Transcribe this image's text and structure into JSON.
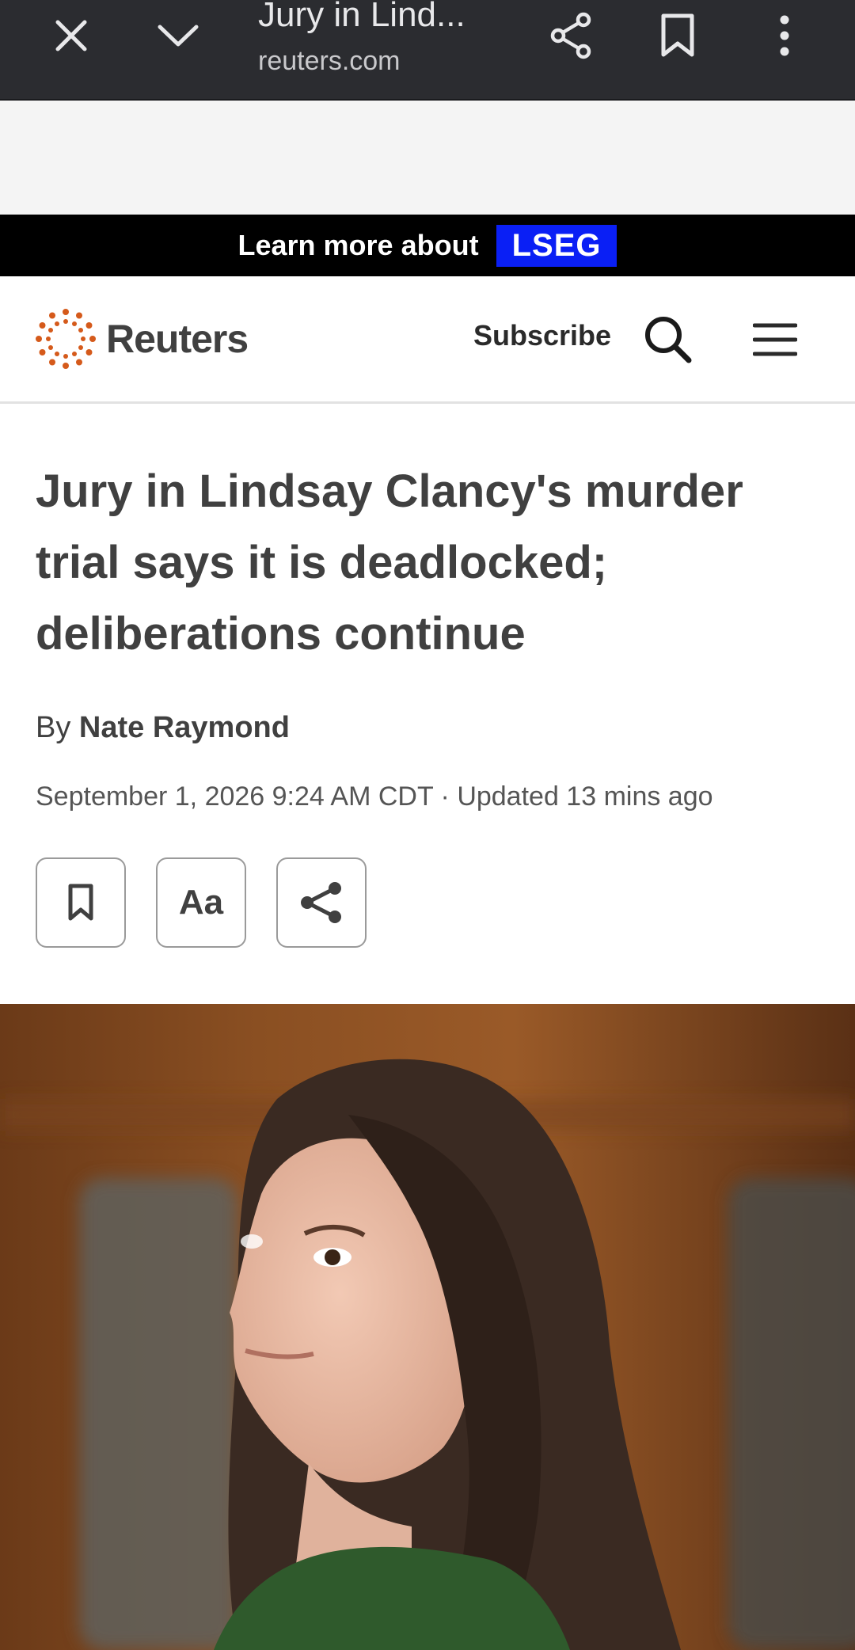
{
  "browser": {
    "tab_title": "Jury in Lind...",
    "url": "reuters.com",
    "icons": [
      "close-icon",
      "chevron-down-icon",
      "share-icon",
      "bookmark-icon",
      "more-vert-icon"
    ]
  },
  "ad": {
    "text": "Learn more about",
    "brand": "LSEG"
  },
  "header": {
    "logo_text": "Reuters",
    "subscribe_label": "Subscribe",
    "icons": [
      "search-icon",
      "hamburger-menu-icon"
    ]
  },
  "article": {
    "headline": "Jury in Lindsay Clancy's murder trial says it is deadlocked; deliberations continue",
    "byline_prefix": "By",
    "author": "Nate Raymond",
    "dateline": "September 1, 2026 9:24 AM CDT · Updated 13 mins ago",
    "tools": {
      "bookmark_icon": "bookmark-icon",
      "text_size_label": "Aa",
      "share_icon": "share-icon"
    }
  },
  "colors": {
    "browser_bar": "#2b2c30",
    "ad_bar": "#000000",
    "ad_brand_bg": "#0a1ff5",
    "reuters_orange": "#d55a1b",
    "text": "#404040"
  }
}
